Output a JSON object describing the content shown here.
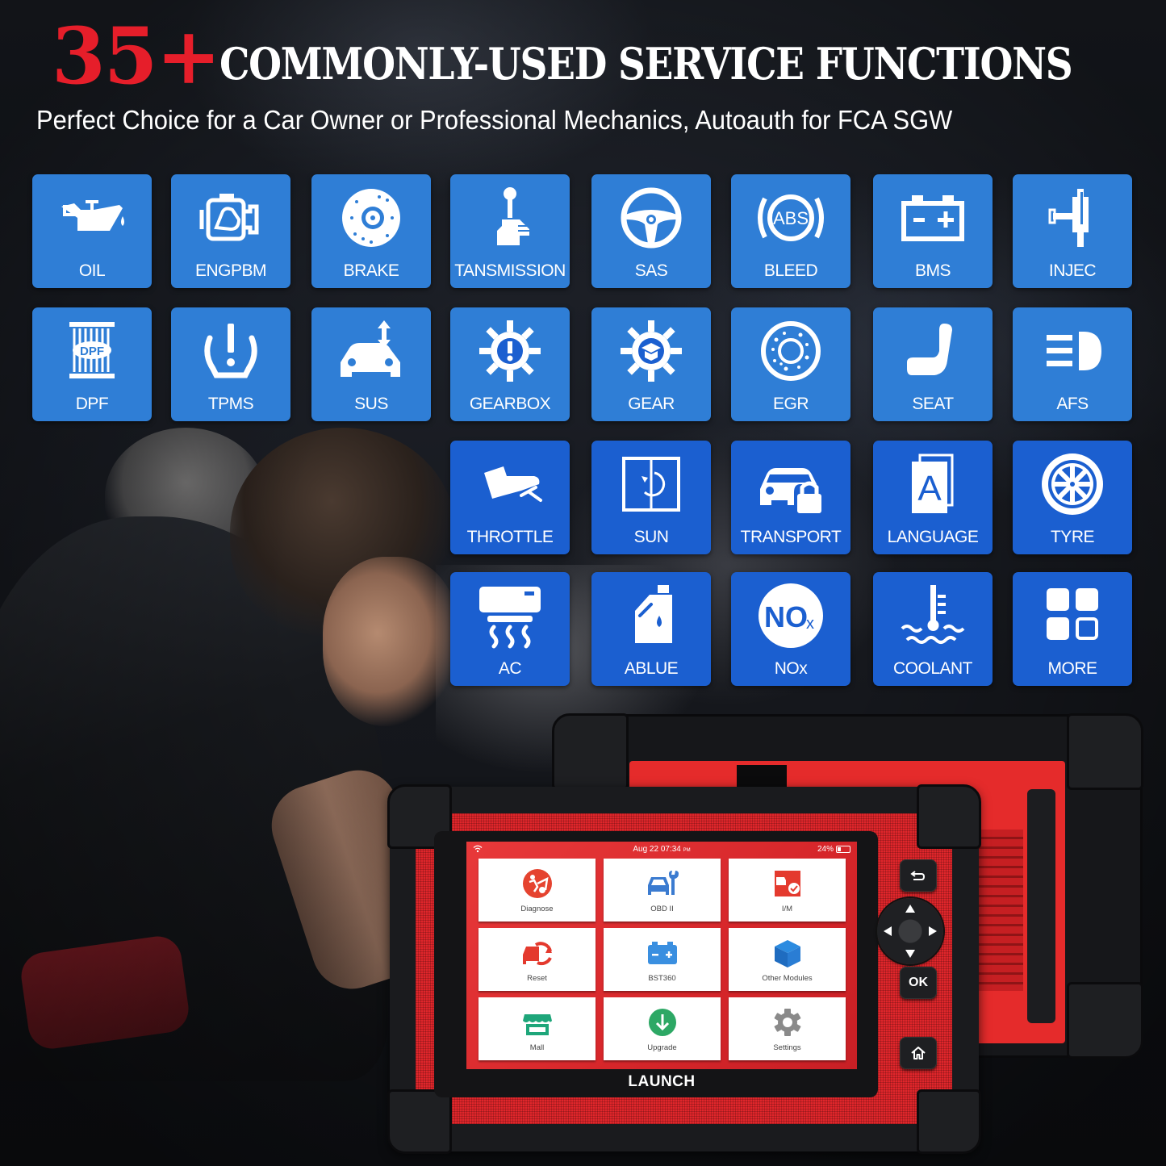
{
  "hero": {
    "number": "35+",
    "title": "COMMONLY-USED SERVICE FUNCTIONS",
    "subtitle": "Perfect Choice for a Car Owner or Professional Mechanics, Autoauth for FCA SGW"
  },
  "colors": {
    "accent_red": "#e61e2a",
    "tile_blue": "#2f7ed6",
    "tile_blue_deep": "#1b5fd0",
    "device_red": "#e0262b"
  },
  "functions": [
    {
      "label": "OIL",
      "icon": "oil-can-icon"
    },
    {
      "label": "ENGPBM",
      "icon": "engine-icon"
    },
    {
      "label": "BRAKE",
      "icon": "brake-disc-icon"
    },
    {
      "label": "TANSMISSION",
      "icon": "gear-shift-icon"
    },
    {
      "label": "SAS",
      "icon": "steering-wheel-icon"
    },
    {
      "label": "BLEED",
      "icon": "abs-icon"
    },
    {
      "label": "BMS",
      "icon": "battery-icon"
    },
    {
      "label": "INJEC",
      "icon": "injector-icon"
    },
    {
      "label": "DPF",
      "icon": "dpf-filter-icon"
    },
    {
      "label": "TPMS",
      "icon": "tire-pressure-icon"
    },
    {
      "label": "SUS",
      "icon": "suspension-car-icon"
    },
    {
      "label": "GEARBOX",
      "icon": "gear-warning-icon"
    },
    {
      "label": "GEAR",
      "icon": "gear-learn-icon"
    },
    {
      "label": "EGR",
      "icon": "egr-valve-icon"
    },
    {
      "label": "SEAT",
      "icon": "seat-icon"
    },
    {
      "label": "AFS",
      "icon": "headlight-icon"
    },
    {
      "label": "THROTTLE",
      "icon": "pedal-foot-icon"
    },
    {
      "label": "SUN",
      "icon": "sunroof-icon"
    },
    {
      "label": "TRANSPORT",
      "icon": "car-lock-icon"
    },
    {
      "label": "LANGUAGE",
      "icon": "language-icon"
    },
    {
      "label": "TYRE",
      "icon": "tyre-icon"
    },
    {
      "label": "AC",
      "icon": "air-conditioner-icon"
    },
    {
      "label": "ABLUE",
      "icon": "fluid-jug-icon"
    },
    {
      "label": "NOx",
      "icon": "nox-icon"
    },
    {
      "label": "COOLANT",
      "icon": "coolant-temp-icon"
    },
    {
      "label": "MORE",
      "icon": "grid-more-icon"
    }
  ],
  "device": {
    "brand": "LAUNCH",
    "status": {
      "date_time": "Aug 22  07:34",
      "ampm": "PM",
      "battery": "24%",
      "battery_level": 0.24
    },
    "apps": [
      {
        "label": "Diagnose",
        "icon": "diagnose-icon"
      },
      {
        "label": "OBD II",
        "icon": "obd-car-wrench-icon"
      },
      {
        "label": "I/M",
        "icon": "im-readiness-icon"
      },
      {
        "label": "Reset",
        "icon": "reset-car-icon"
      },
      {
        "label": "BST360",
        "icon": "battery-test-icon"
      },
      {
        "label": "Other Modules",
        "icon": "cube-icon"
      },
      {
        "label": "Mall",
        "icon": "store-icon"
      },
      {
        "label": "Upgrade",
        "icon": "download-icon"
      },
      {
        "label": "Settings",
        "icon": "settings-gear-icon"
      }
    ],
    "buttons": {
      "back": "back-arrow-icon",
      "ok": "OK",
      "home": "home-icon"
    }
  }
}
